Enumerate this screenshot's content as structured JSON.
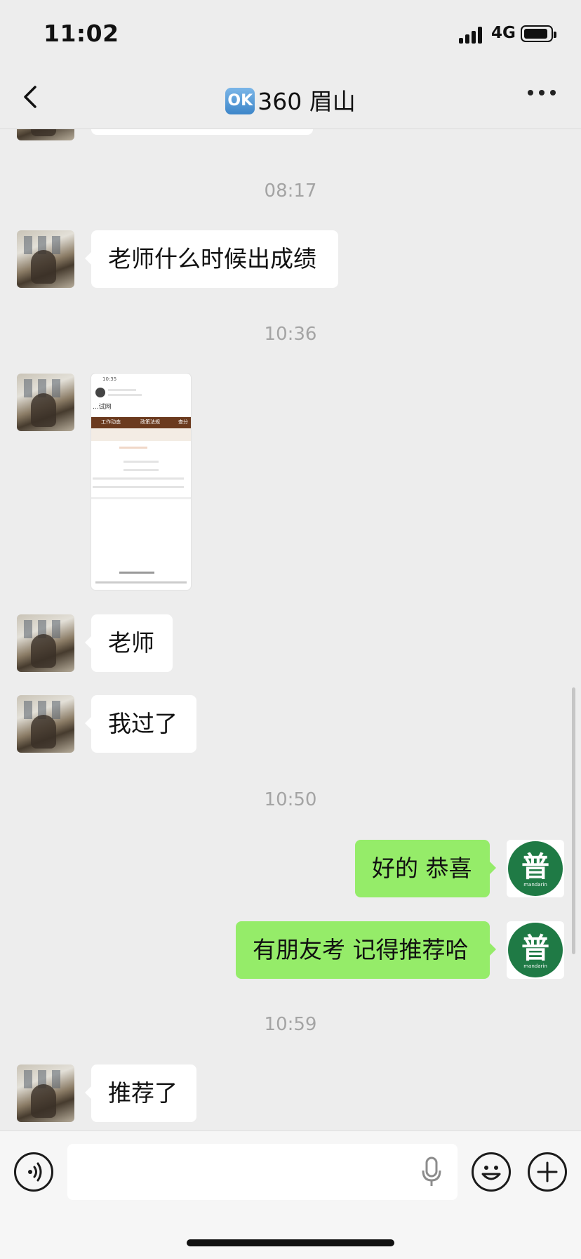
{
  "status_bar": {
    "time": "11:02",
    "network": "4G"
  },
  "nav": {
    "badge": "OK",
    "title": "360 眉山"
  },
  "messages": [
    {
      "type": "timestamp",
      "text": "08:17"
    },
    {
      "type": "text",
      "side": "left",
      "text": "老师什么时候出成绩"
    },
    {
      "type": "timestamp",
      "text": "10:36"
    },
    {
      "type": "image",
      "side": "left"
    },
    {
      "type": "text",
      "side": "left",
      "text": "老师"
    },
    {
      "type": "text",
      "side": "left",
      "text": "我过了"
    },
    {
      "type": "timestamp",
      "text": "10:50"
    },
    {
      "type": "text",
      "side": "right",
      "text": "好的 恭喜"
    },
    {
      "type": "text",
      "side": "right",
      "text": "有朋友考 记得推荐哈"
    },
    {
      "type": "timestamp",
      "text": "10:59"
    },
    {
      "type": "text",
      "side": "left",
      "text": "推荐了"
    }
  ],
  "screenshot_thumb": {
    "time": "10:35",
    "site_name": "...试网",
    "tabs": [
      "工作动态",
      "政策法规",
      "查分"
    ]
  },
  "self_avatar": {
    "character": "普",
    "caption": "mandarin"
  },
  "input": {
    "placeholder": ""
  },
  "colors": {
    "background": "#ededed",
    "bubble_self": "#95ec69",
    "bubble_other": "#ffffff",
    "avatar_green": "#1f7a45"
  },
  "icons": [
    "back-chevron-icon",
    "more-icon",
    "voice-icon",
    "mic-icon",
    "emoji-icon",
    "plus-icon"
  ]
}
